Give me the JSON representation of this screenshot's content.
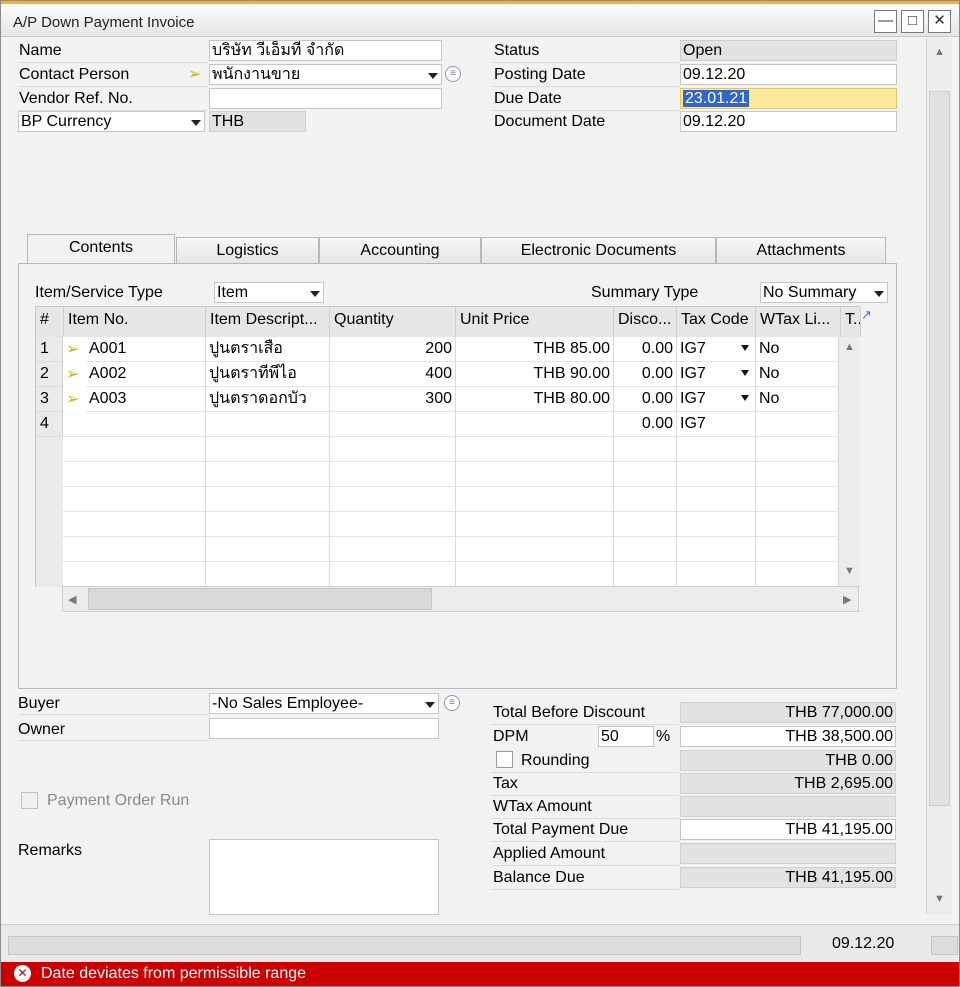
{
  "window": {
    "title": "A/P Down Payment Invoice"
  },
  "header_left": {
    "name_label": "Name",
    "name_value": "บริษัท วีเอ็มที จำกัด",
    "contact_label": "Contact Person",
    "contact_value": "พนักงานขาย",
    "vendor_ref_label": "Vendor Ref. No.",
    "vendor_ref_value": "",
    "currency_label": "BP Currency",
    "currency_value": "THB"
  },
  "header_right": {
    "status_label": "Status",
    "status_value": "Open",
    "posting_date_label": "Posting Date",
    "posting_date_value": "09.12.20",
    "due_date_label": "Due Date",
    "due_date_value": "23.01.21",
    "document_date_label": "Document Date",
    "document_date_value": "09.12.20"
  },
  "tabs": [
    "Contents",
    "Logistics",
    "Accounting",
    "Electronic Documents",
    "Attachments"
  ],
  "contents": {
    "item_type_label": "Item/Service Type",
    "item_type_value": "Item",
    "summary_type_label": "Summary Type",
    "summary_type_value": "No Summary",
    "columns": [
      "#",
      "Item No.",
      "Item Descript...",
      "Quantity",
      "Unit Price",
      "Disco...",
      "Tax Code",
      "WTax Li...",
      "T..."
    ],
    "rows": [
      {
        "num": "1",
        "item_no": "A001",
        "desc": "ปูนตราเสือ",
        "qty": "200",
        "price": "THB 85.00",
        "disc": "0.00",
        "tax": "IG7",
        "wtax": "No"
      },
      {
        "num": "2",
        "item_no": "A002",
        "desc": "ปูนตราทีพีไอ",
        "qty": "400",
        "price": "THB 90.00",
        "disc": "0.00",
        "tax": "IG7",
        "wtax": "No"
      },
      {
        "num": "3",
        "item_no": "A003",
        "desc": "ปูนตราดอกบัว",
        "qty": "300",
        "price": "THB 80.00",
        "disc": "0.00",
        "tax": "IG7",
        "wtax": "No"
      },
      {
        "num": "4",
        "item_no": "",
        "desc": "",
        "qty": "",
        "price": "",
        "disc": "0.00",
        "tax": "IG7",
        "wtax": ""
      }
    ]
  },
  "footer_left": {
    "buyer_label": "Buyer",
    "buyer_value": "-No Sales Employee-",
    "owner_label": "Owner",
    "owner_value": "",
    "payment_order_label": "Payment Order Run",
    "remarks_label": "Remarks",
    "remarks_value": ""
  },
  "totals": {
    "total_before_discount_label": "Total Before Discount",
    "total_before_discount_value": "THB 77,000.00",
    "dpm_label": "DPM",
    "dpm_percent": "50",
    "dpm_percent_sign": "%",
    "dpm_value": "THB 38,500.00",
    "rounding_label": "Rounding",
    "rounding_value": "THB 0.00",
    "tax_label": "Tax",
    "tax_value": "THB 2,695.00",
    "wtax_label": "WTax Amount",
    "wtax_value": "",
    "total_payment_due_label": "Total Payment Due",
    "total_payment_due_value": "THB 41,195.00",
    "applied_amount_label": "Applied Amount",
    "applied_amount_value": "",
    "balance_due_label": "Balance Due",
    "balance_due_value": "THB 41,195.00"
  },
  "statusbar": {
    "date": "09.12.20"
  },
  "error": {
    "message": "Date deviates from permissible range"
  },
  "colors": {
    "accent_orange": "#f0b23c",
    "highlight_yellow": "#ffe79a",
    "error_red": "#cc0000",
    "selection_blue": "#3066cc"
  },
  "icons": [
    "minimize-icon",
    "maximize-icon",
    "close-icon",
    "link-arrow-icon",
    "list-icon",
    "expand-icon",
    "error-icon"
  ]
}
